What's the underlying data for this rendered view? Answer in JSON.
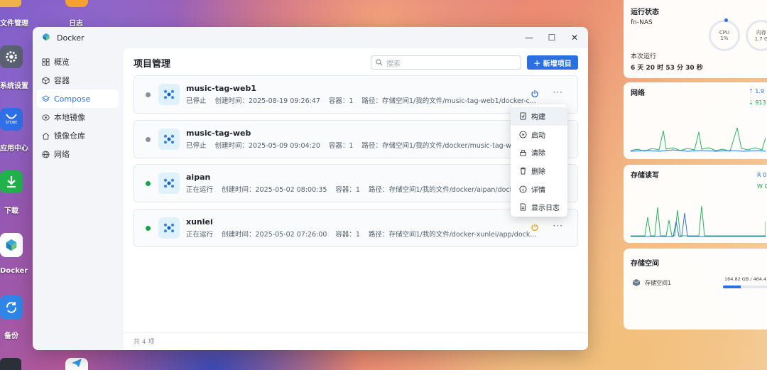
{
  "desktop": {
    "icons": [
      {
        "label": "文件管理"
      },
      {
        "label": "日志"
      },
      {
        "label": "系统设置"
      },
      {
        "label": "应用中心",
        "badge": "STORE"
      },
      {
        "label": "下载"
      },
      {
        "label": "Docker"
      },
      {
        "label": "备份"
      }
    ]
  },
  "window": {
    "title": "Docker",
    "controls": {
      "minimize": "—",
      "maximize": "☐",
      "close": "✕"
    }
  },
  "sidebar": {
    "items": [
      {
        "label": "概览",
        "icon": "grid-icon"
      },
      {
        "label": "容器",
        "icon": "cube-icon"
      },
      {
        "label": "Compose",
        "icon": "layers-icon",
        "active": true
      },
      {
        "label": "本地镜像",
        "icon": "disc-icon"
      },
      {
        "label": "镜像仓库",
        "icon": "house-icon"
      },
      {
        "label": "网络",
        "icon": "globe-icon"
      }
    ]
  },
  "main": {
    "title": "项目管理",
    "search_placeholder": "搜索",
    "add_button": "＋ 新增项目",
    "footer": "共 4 项"
  },
  "projects": [
    {
      "name": "music-tag-web1",
      "status": "已停止",
      "created": "创建时间：2025-08-19 09:26:47",
      "containers": "容器：1",
      "path": "路径：存储空间1/我的文件/music-tag-web1/docker-c...",
      "running": false
    },
    {
      "name": "music-tag-web",
      "status": "已停止",
      "created": "创建时间：2025-05-09 09:04:20",
      "containers": "容器：1",
      "path": "路径：存储空间1/我的文件/docker/music-tag-web/do...",
      "running": false
    },
    {
      "name": "aipan",
      "status": "正在运行",
      "created": "创建时间：2025-05-02 08:00:35",
      "containers": "容器：1",
      "path": "路径：存储空间1/我的文件/docker/aipan/docker-co...",
      "running": true
    },
    {
      "name": "xunlei",
      "status": "正在运行",
      "created": "创建时间：2025-05-02 07:26:00",
      "containers": "容器：1",
      "path": "路径：存储空间1/我的文件/docker-xunlei/app/dock...",
      "running": true
    }
  ],
  "context_menu": {
    "items": [
      {
        "label": "构建",
        "icon": "build-icon"
      },
      {
        "label": "启动",
        "icon": "play-icon"
      },
      {
        "label": "清除",
        "icon": "clear-icon"
      },
      {
        "label": "删除",
        "icon": "trash-icon"
      },
      {
        "label": "详情",
        "icon": "info-icon"
      },
      {
        "label": "显示日志",
        "icon": "log-icon"
      }
    ]
  },
  "widgets": {
    "status": {
      "title": "运行状态",
      "host": "fn-NAS",
      "cpu_label": "CPU",
      "cpu_value": "1%",
      "mem_label": "内存",
      "mem_value": "1.7 G",
      "uptime_label": "本次运行",
      "uptime": "6 天 20 时 53 分 30 秒"
    },
    "network": {
      "title": "网络",
      "up": "1.9",
      "down": "913"
    },
    "disk_io": {
      "title": "存储读写",
      "read": "R 0",
      "write": "W 0"
    },
    "storage": {
      "title": "存储空间",
      "volume": "存储空间1",
      "usage": "164.82 GB / 464.4",
      "fill": 0.355
    }
  },
  "colors": {
    "accent": "#2b6fe0",
    "running": "#17a34a",
    "stopped": "#8a8f99",
    "power_on": "#2b6fe0",
    "power_off": "#f0a020"
  }
}
